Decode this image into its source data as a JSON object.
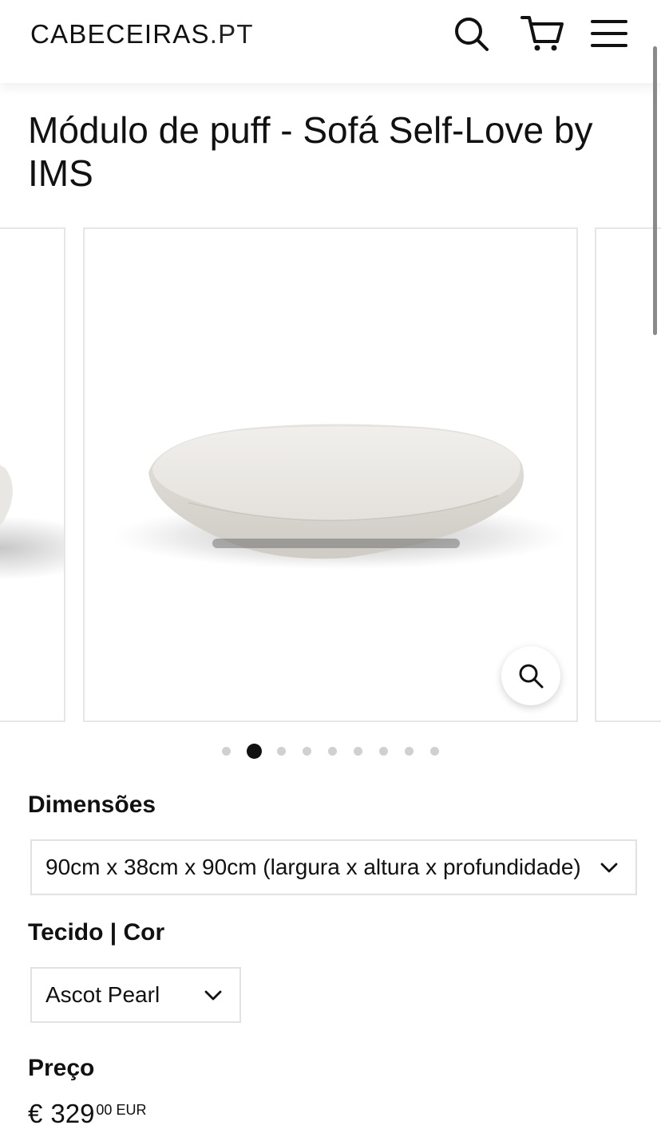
{
  "header": {
    "logo_main": "CABECEIRAS",
    "logo_suffix": ".PT",
    "icons": [
      "search-icon",
      "cart-icon",
      "menu-icon"
    ]
  },
  "product": {
    "title": "Módulo de puff - Sofá Self-Love by IMS"
  },
  "gallery": {
    "slide_count": 9,
    "active_index": 1,
    "zoom_icon": "zoom-icon"
  },
  "options": {
    "dimensions": {
      "label": "Dimensões",
      "selected": "90cm x 38cm x 90cm (largura x altura x profundidade)"
    },
    "fabric": {
      "label": "Tecido | Cor",
      "selected": "Ascot Pearl"
    }
  },
  "price": {
    "label": "Preço",
    "currency_symbol": "€",
    "amount": "329",
    "cents": "00",
    "currency_code": "EUR"
  },
  "colors": {
    "text": "#111111",
    "border": "#e2e2e2",
    "dot_inactive": "#d0d0d0",
    "dot_active": "#111111"
  }
}
